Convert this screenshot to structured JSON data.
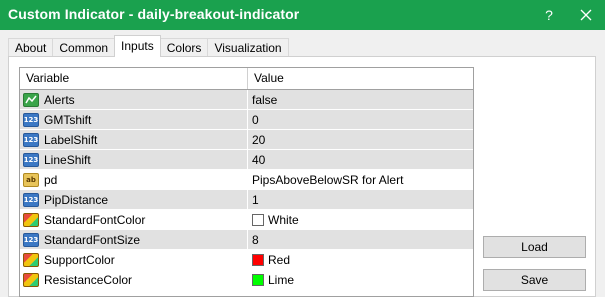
{
  "window": {
    "title": "Custom Indicator - daily-breakout-indicator",
    "help_label": "?",
    "title_bar_color": "#1aa14e"
  },
  "tabs": [
    {
      "label": "About"
    },
    {
      "label": "Common"
    },
    {
      "label": "Inputs"
    },
    {
      "label": "Colors"
    },
    {
      "label": "Visualization"
    }
  ],
  "active_tab": "Inputs",
  "grid": {
    "columns": {
      "variable": "Variable",
      "value": "Value"
    },
    "rows": [
      {
        "variable": "Alerts",
        "value": "false",
        "icon": "bool-icon"
      },
      {
        "variable": "GMTshift",
        "value": "0",
        "icon": "int-icon"
      },
      {
        "variable": "LabelShift",
        "value": "20",
        "icon": "int-icon"
      },
      {
        "variable": "LineShift",
        "value": "40",
        "icon": "int-icon"
      },
      {
        "variable": "pd",
        "value": "PipsAboveBelowSR for Alert",
        "icon": "string-icon"
      },
      {
        "variable": "PipDistance",
        "value": "1",
        "icon": "int-icon"
      },
      {
        "variable": "StandardFontColor",
        "value": "White",
        "icon": "color-icon",
        "swatch": "#ffffff"
      },
      {
        "variable": "StandardFontSize",
        "value": "8",
        "icon": "int-icon"
      },
      {
        "variable": "SupportColor",
        "value": "Red",
        "icon": "color-icon",
        "swatch": "#ff0000"
      },
      {
        "variable": "ResistanceColor",
        "value": "Lime",
        "icon": "color-icon",
        "swatch": "#00ff00"
      }
    ]
  },
  "buttons": {
    "load_label": "Load",
    "save_label": "Save"
  }
}
